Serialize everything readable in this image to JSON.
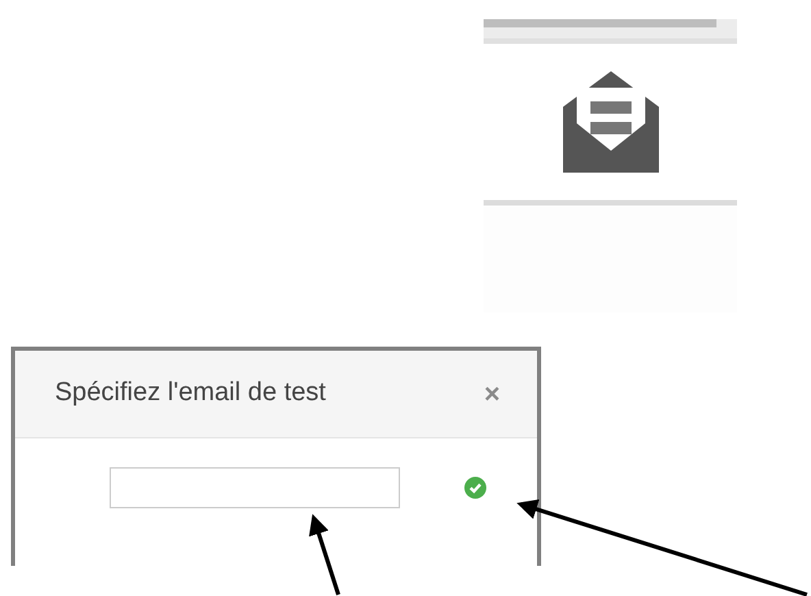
{
  "panel": {
    "progress": {
      "level": 0.92
    }
  },
  "dialog": {
    "title": "Spécifiez l'email de test",
    "close": "×",
    "email_field": {
      "valid": true
    }
  }
}
